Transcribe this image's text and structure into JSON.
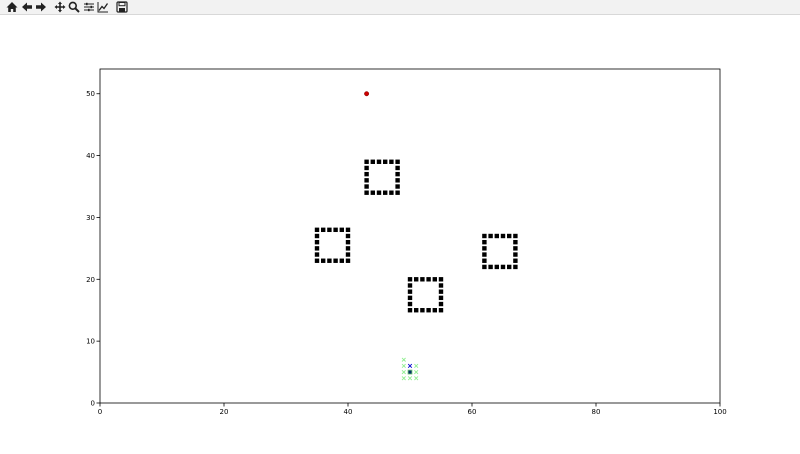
{
  "toolbar": {
    "buttons": [
      {
        "name": "home-icon"
      },
      {
        "name": "back-arrow-icon"
      },
      {
        "name": "forward-arrow-icon"
      },
      {
        "name": "pan-move-icon"
      },
      {
        "name": "zoom-magnifier-icon"
      },
      {
        "name": "configure-subplots-icon"
      },
      {
        "name": "edit-axis-line-icon"
      },
      {
        "name": "save-floppy-icon"
      }
    ]
  },
  "chart_data": {
    "type": "scatter",
    "title": "",
    "xlabel": "",
    "ylabel": "",
    "xlim": [
      0,
      100
    ],
    "ylim": [
      0,
      54
    ],
    "grid": false,
    "x_ticks": [
      0,
      20,
      40,
      60,
      80,
      100
    ],
    "y_ticks": [
      0,
      10,
      20,
      30,
      40,
      50
    ],
    "x_tick_labels": [
      "0",
      "20",
      "40",
      "60",
      "80",
      "100"
    ],
    "y_tick_labels": [
      "0",
      "10",
      "20",
      "30",
      "40",
      "50"
    ],
    "series": [
      {
        "marker": "square",
        "color": "#000000",
        "points": [
          [
            43,
            34
          ],
          [
            44,
            34
          ],
          [
            45,
            34
          ],
          [
            46,
            34
          ],
          [
            47,
            34
          ],
          [
            48,
            34
          ],
          [
            43,
            39
          ],
          [
            44,
            39
          ],
          [
            45,
            39
          ],
          [
            46,
            39
          ],
          [
            47,
            39
          ],
          [
            48,
            39
          ],
          [
            43,
            35
          ],
          [
            43,
            36
          ],
          [
            43,
            37
          ],
          [
            43,
            38
          ],
          [
            48,
            35
          ],
          [
            48,
            36
          ],
          [
            48,
            37
          ],
          [
            48,
            38
          ],
          [
            35,
            23
          ],
          [
            36,
            23
          ],
          [
            37,
            23
          ],
          [
            38,
            23
          ],
          [
            39,
            23
          ],
          [
            40,
            23
          ],
          [
            35,
            28
          ],
          [
            36,
            28
          ],
          [
            37,
            28
          ],
          [
            38,
            28
          ],
          [
            39,
            28
          ],
          [
            40,
            28
          ],
          [
            35,
            24
          ],
          [
            35,
            25
          ],
          [
            35,
            26
          ],
          [
            35,
            27
          ],
          [
            40,
            24
          ],
          [
            40,
            25
          ],
          [
            40,
            26
          ],
          [
            40,
            27
          ],
          [
            62,
            22
          ],
          [
            63,
            22
          ],
          [
            64,
            22
          ],
          [
            65,
            22
          ],
          [
            66,
            22
          ],
          [
            67,
            22
          ],
          [
            62,
            27
          ],
          [
            63,
            27
          ],
          [
            64,
            27
          ],
          [
            65,
            27
          ],
          [
            66,
            27
          ],
          [
            67,
            27
          ],
          [
            62,
            23
          ],
          [
            62,
            24
          ],
          [
            62,
            25
          ],
          [
            62,
            26
          ],
          [
            67,
            23
          ],
          [
            67,
            24
          ],
          [
            67,
            25
          ],
          [
            67,
            26
          ],
          [
            50,
            15
          ],
          [
            51,
            15
          ],
          [
            52,
            15
          ],
          [
            53,
            15
          ],
          [
            54,
            15
          ],
          [
            55,
            15
          ],
          [
            50,
            20
          ],
          [
            51,
            20
          ],
          [
            52,
            20
          ],
          [
            53,
            20
          ],
          [
            54,
            20
          ],
          [
            55,
            20
          ],
          [
            50,
            16
          ],
          [
            50,
            17
          ],
          [
            50,
            18
          ],
          [
            50,
            19
          ],
          [
            55,
            16
          ],
          [
            55,
            17
          ],
          [
            55,
            18
          ],
          [
            55,
            19
          ]
        ]
      },
      {
        "marker": "circle",
        "color": "#cc0000",
        "points": [
          [
            43,
            50
          ]
        ]
      },
      {
        "marker": "x",
        "color": "#90ee90",
        "points": [
          [
            49,
            7
          ],
          [
            49,
            6
          ],
          [
            49,
            5
          ],
          [
            49,
            4
          ],
          [
            51,
            6
          ],
          [
            51,
            5
          ],
          [
            51,
            4
          ],
          [
            50,
            4
          ]
        ]
      },
      {
        "marker": "x",
        "color": "#0000cc",
        "points": [
          [
            50,
            6
          ]
        ]
      },
      {
        "marker": "square-outlined",
        "color": "#003366",
        "points": [
          [
            50,
            5
          ]
        ]
      }
    ]
  }
}
